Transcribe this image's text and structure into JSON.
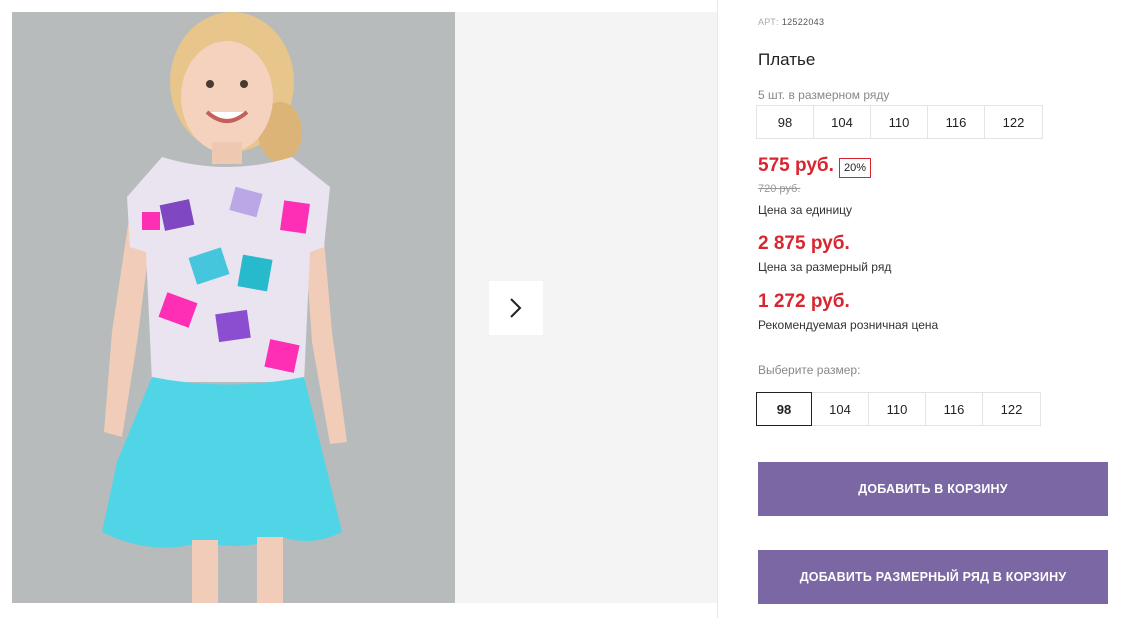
{
  "product": {
    "article_label": "АРТ:",
    "article_number": "12522043",
    "title": "Платье"
  },
  "gallery": {
    "next_icon": "chevron-right-icon"
  },
  "size_row": {
    "note": "5 шт. в размерном ряду",
    "sizes": [
      "98",
      "104",
      "110",
      "116",
      "122"
    ]
  },
  "prices": {
    "unit_price": "575 руб.",
    "discount": "20%",
    "old_price": "720 руб.",
    "unit_label": "Цена за единицу",
    "row_price": "2 875 руб.",
    "row_label": "Цена за размерный ряд",
    "rrp_price": "1 272 руб.",
    "rrp_label": "Рекомендуемая розничная цена"
  },
  "size_select": {
    "label": "Выберите размер:",
    "sizes": [
      "98",
      "104",
      "110",
      "116",
      "122"
    ],
    "selected": "98"
  },
  "actions": {
    "add_to_cart": "ДОБАВИТЬ В КОРЗИНУ",
    "add_row_to_cart": "ДОБАВИТЬ РАЗМЕРНЫЙ РЯД В КОРЗИНУ"
  },
  "colors": {
    "price": "#d7262f",
    "button": "#7b67a4"
  }
}
